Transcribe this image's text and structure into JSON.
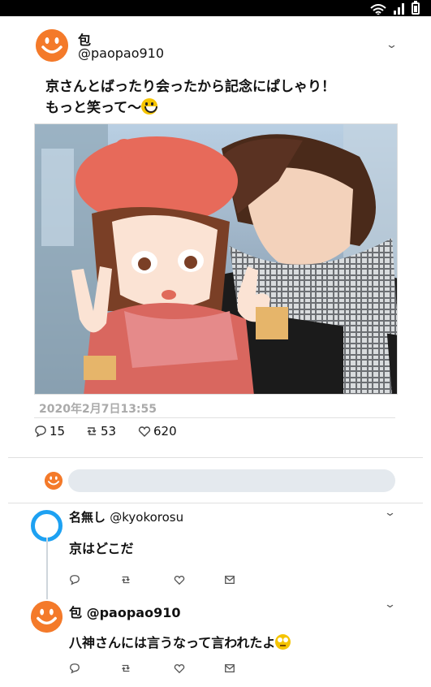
{
  "status_bar": {
    "icons": [
      "wifi-icon",
      "signal-icon",
      "battery-icon"
    ]
  },
  "colors": {
    "accent": "#1da1f2",
    "avatar_orange": "#f47a2a",
    "input_bg": "#e4e9ee",
    "muted": "#aaaaaa"
  },
  "tweet": {
    "author_name": "包",
    "author_handle": "@paopao910",
    "text_line1": "京さんとばったり会ったから記念にぱしゃり！",
    "text_line2": "もっと笑って〜",
    "timestamp": "2020年2月7日13:55",
    "stats": {
      "replies": "15",
      "retweets": "53",
      "likes": "620"
    }
  },
  "compose": {
    "placeholder": ""
  },
  "replies": [
    {
      "name": "名無し",
      "handle": "@kyokorosu",
      "text": "京はどこだ"
    },
    {
      "name": "包",
      "handle": "@paopao910",
      "text": "八神さんには言うなって言われたよ"
    }
  ]
}
